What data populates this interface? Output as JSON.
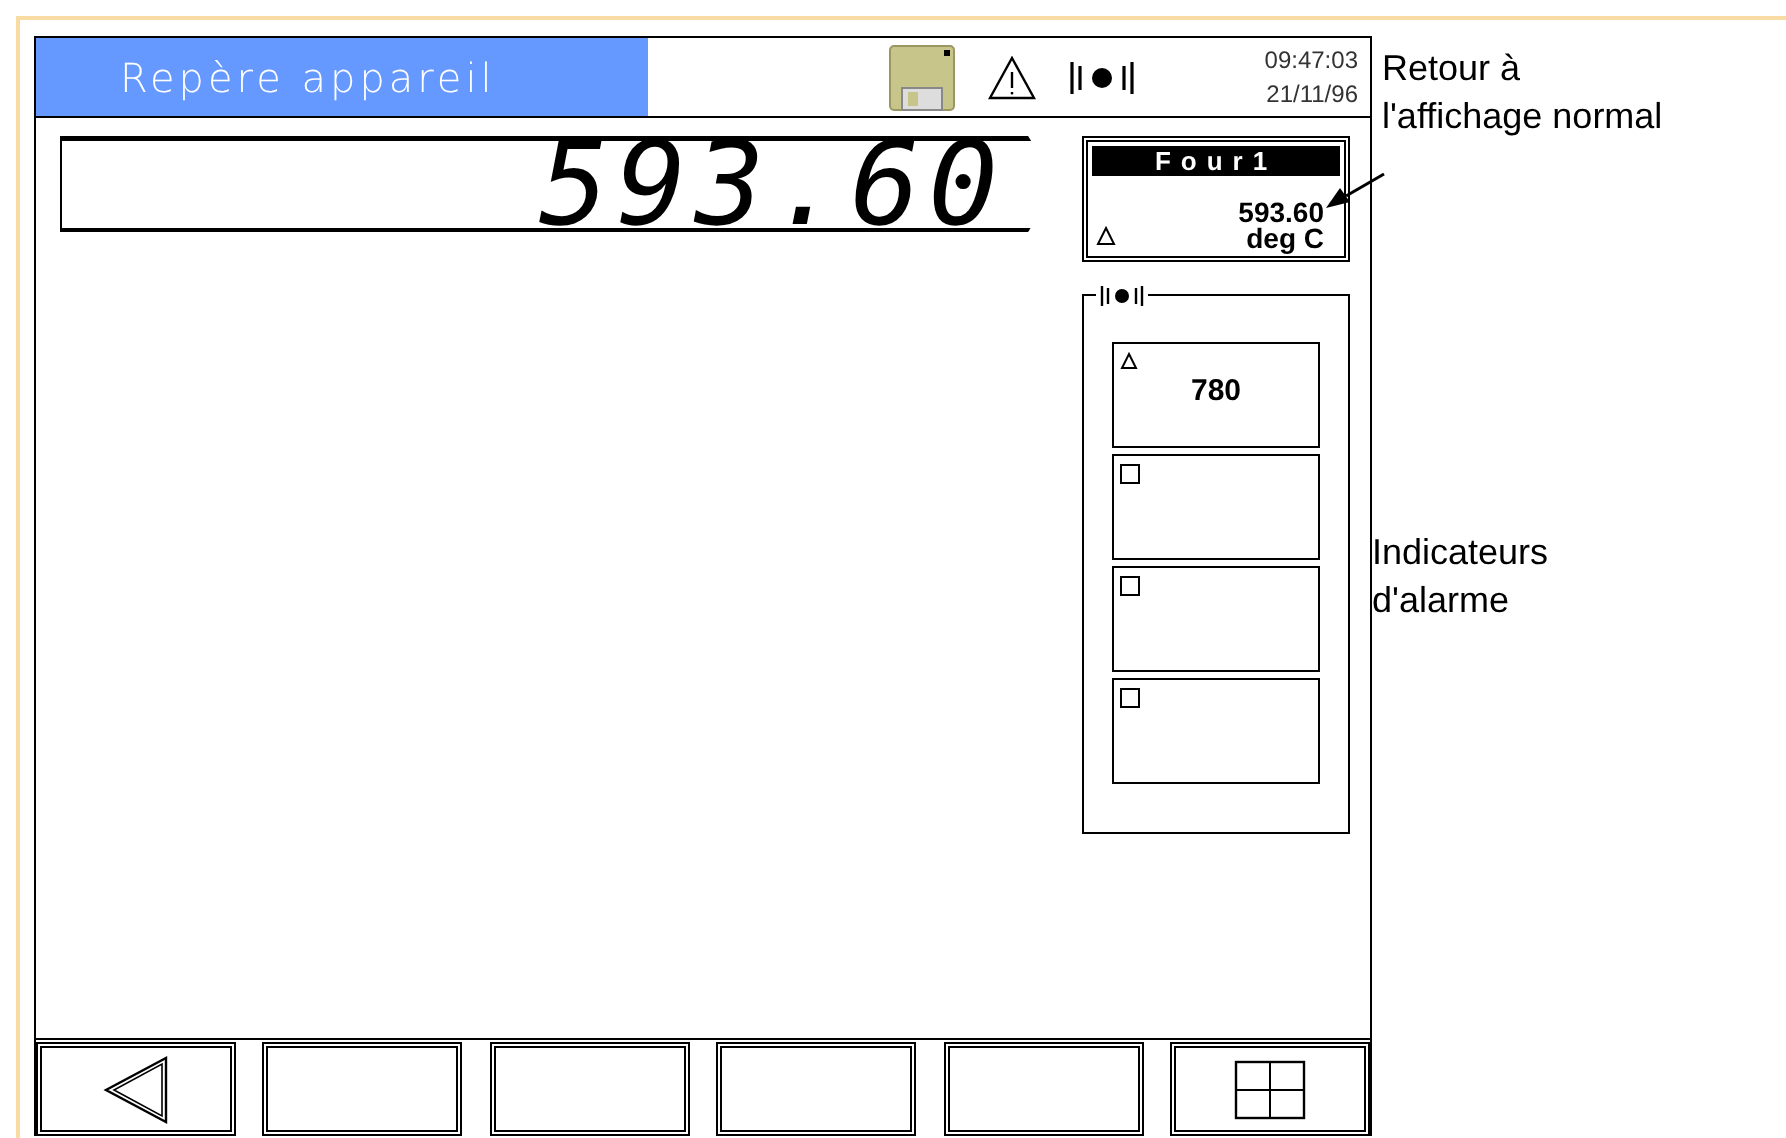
{
  "header": {
    "title": "Repère appareil",
    "time": "09:47:03",
    "date": "21/11/96"
  },
  "main_display": {
    "value": "593.60"
  },
  "channel": {
    "tag": "Four1",
    "value": "593.60",
    "unit": "deg C",
    "alarm": true
  },
  "alarm_panel": {
    "indicators": [
      {
        "kind": "active",
        "value": "780"
      },
      {
        "kind": "inactive"
      },
      {
        "kind": "inactive"
      },
      {
        "kind": "inactive"
      }
    ]
  },
  "softkeys": [
    {
      "kind": "back"
    },
    {
      "kind": "blank"
    },
    {
      "kind": "blank"
    },
    {
      "kind": "blank"
    },
    {
      "kind": "blank"
    },
    {
      "kind": "grid"
    }
  ],
  "annotations": [
    {
      "text": "Retour à\nl'affichage normal",
      "kind": "arrow"
    },
    {
      "text": "Indicateurs\nd'alarme",
      "kind": "plain"
    }
  ]
}
